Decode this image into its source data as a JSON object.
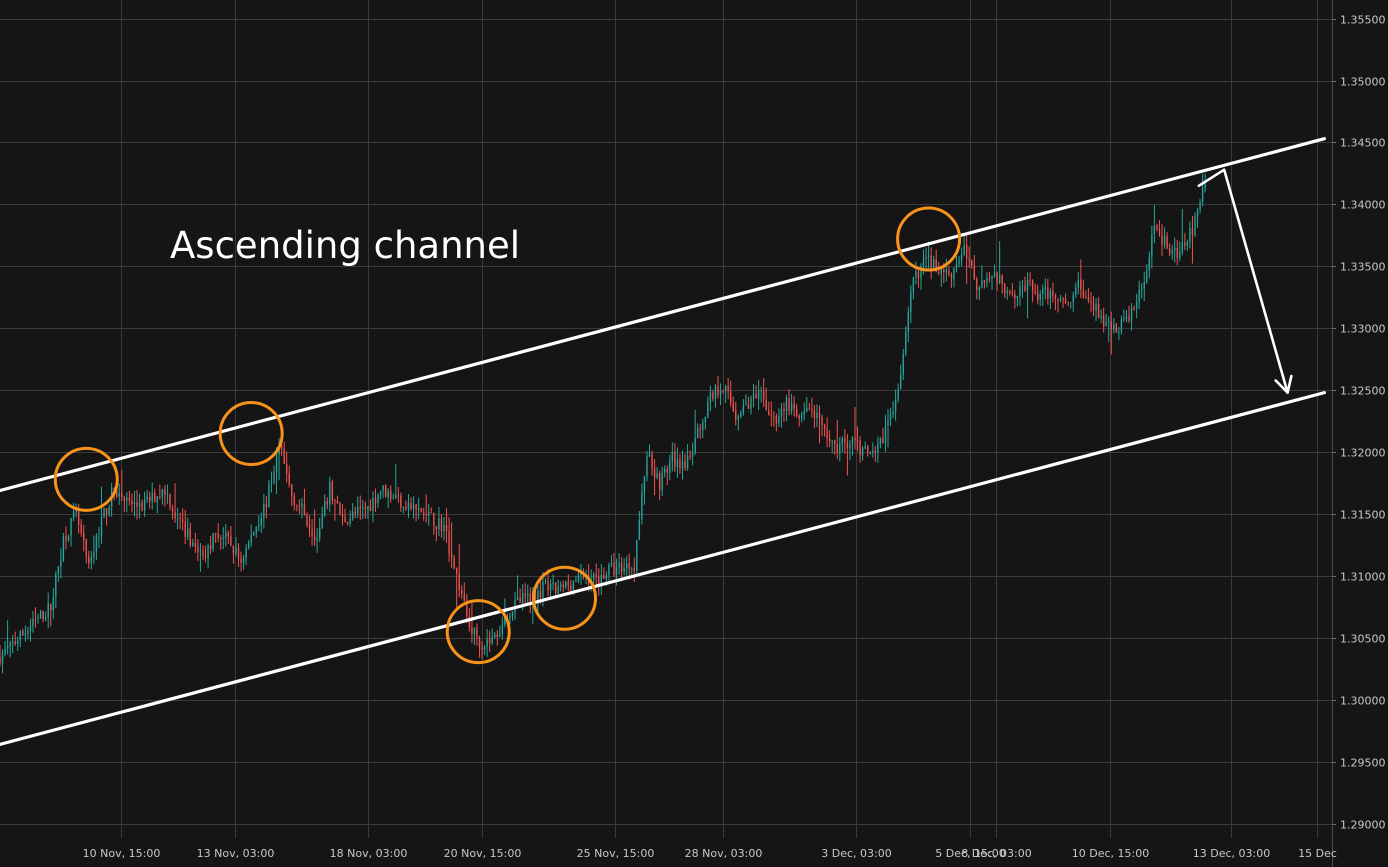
{
  "chart_data": {
    "type": "candlestick",
    "annotation_text": "Ascending channel",
    "y_axis": {
      "range": [
        1.2865,
        1.3565
      ],
      "ticks": [
        "1.35500",
        "1.35000",
        "1.34500",
        "1.34000",
        "1.33500",
        "1.33000",
        "1.32500",
        "1.32000",
        "1.31500",
        "1.31000",
        "1.30500",
        "1.30000",
        "1.29500",
        "1.29000"
      ]
    },
    "x_axis": {
      "ticks": [
        "10 Nov, 15:00",
        "13 Nov, 03:00",
        "18 Nov, 03:00",
        "20 Nov, 15:00",
        "25 Nov, 15:00",
        "28 Nov, 03:00",
        "3 Dec, 03:00",
        "5 Dec, 15:00",
        "8 Dec, 03:00",
        "10 Dec, 15:00",
        "13 Dec, 03:00",
        "15 Dec"
      ]
    },
    "grid": true,
    "colors": {
      "up": "#26a69a",
      "down": "#ef5350",
      "grid": "#3a3a3a",
      "lines": "#ffffff",
      "circles": "#f7931a"
    },
    "price_path": [
      [
        0,
        1.3035
      ],
      [
        2,
        1.3055
      ],
      [
        4,
        1.3075
      ],
      [
        5,
        1.313
      ],
      [
        6,
        1.315
      ],
      [
        7,
        1.3105
      ],
      [
        8,
        1.3145
      ],
      [
        9,
        1.317
      ],
      [
        10,
        1.316
      ],
      [
        11,
        1.3155
      ],
      [
        13,
        1.317
      ],
      [
        14,
        1.3145
      ],
      [
        15,
        1.313
      ],
      [
        16,
        1.3115
      ],
      [
        17,
        1.3135
      ],
      [
        18,
        1.3128
      ],
      [
        19,
        1.3112
      ],
      [
        21,
        1.316
      ],
      [
        22,
        1.3205
      ],
      [
        23,
        1.3165
      ],
      [
        24,
        1.315
      ],
      [
        25,
        1.313
      ],
      [
        26,
        1.317
      ],
      [
        27,
        1.3145
      ],
      [
        28,
        1.315
      ],
      [
        29,
        1.3155
      ],
      [
        30,
        1.317
      ],
      [
        31,
        1.3165
      ],
      [
        32,
        1.3158
      ],
      [
        33,
        1.3152
      ],
      [
        35,
        1.314
      ],
      [
        36,
        1.31
      ],
      [
        37,
        1.306
      ],
      [
        38,
        1.3045
      ],
      [
        39,
        1.305
      ],
      [
        40,
        1.307
      ],
      [
        41,
        1.308
      ],
      [
        42,
        1.3085
      ],
      [
        43,
        1.309
      ],
      [
        44,
        1.3088
      ],
      [
        45,
        1.3095
      ],
      [
        46,
        1.31
      ],
      [
        47,
        1.3097
      ],
      [
        48,
        1.3105
      ],
      [
        50,
        1.311
      ],
      [
        51,
        1.32
      ],
      [
        52,
        1.3175
      ],
      [
        53,
        1.3195
      ],
      [
        54,
        1.3185
      ],
      [
        55,
        1.3215
      ],
      [
        56,
        1.3245
      ],
      [
        57,
        1.3255
      ],
      [
        58,
        1.323
      ],
      [
        59,
        1.324
      ],
      [
        60,
        1.3245
      ],
      [
        61,
        1.3225
      ],
      [
        62,
        1.324
      ],
      [
        63,
        1.3225
      ],
      [
        64,
        1.3235
      ],
      [
        65,
        1.3215
      ],
      [
        66,
        1.3205
      ],
      [
        67,
        1.321
      ],
      [
        68,
        1.32
      ],
      [
        69,
        1.3195
      ],
      [
        70,
        1.3225
      ],
      [
        71,
        1.326
      ],
      [
        72,
        1.334
      ],
      [
        73,
        1.3355
      ],
      [
        74,
        1.3348
      ],
      [
        75,
        1.3345
      ],
      [
        76,
        1.3365
      ],
      [
        77,
        1.3335
      ],
      [
        78,
        1.3345
      ],
      [
        79,
        1.3335
      ],
      [
        80,
        1.333
      ],
      [
        81,
        1.3335
      ],
      [
        82,
        1.3325
      ],
      [
        83,
        1.333
      ],
      [
        84,
        1.332
      ],
      [
        85,
        1.3335
      ],
      [
        86,
        1.332
      ],
      [
        87,
        1.3305
      ],
      [
        88,
        1.33
      ],
      [
        89,
        1.331
      ],
      [
        90,
        1.333
      ],
      [
        91,
        1.3385
      ],
      [
        92,
        1.3365
      ],
      [
        93,
        1.336
      ],
      [
        94,
        1.338
      ],
      [
        95,
        1.3415
      ]
    ],
    "channel_lines": [
      {
        "name": "upper",
        "from": [
          -2.2,
          1.3163
        ],
        "to": [
          104.4,
          1.3453
        ]
      },
      {
        "name": "lower",
        "from": [
          -2.2,
          1.2958
        ],
        "to": [
          104.4,
          1.3248
        ]
      }
    ],
    "projection_arrow": {
      "from": [
        94.5,
        1.3415
      ],
      "peak": [
        96.5,
        1.3428
      ],
      "to": [
        101.5,
        1.3248
      ]
    },
    "circled_points": [
      [
        6.8,
        1.3178
      ],
      [
        19.8,
        1.3215
      ],
      [
        37.7,
        1.3055
      ],
      [
        44.5,
        1.3082
      ],
      [
        73.2,
        1.3372
      ]
    ]
  }
}
